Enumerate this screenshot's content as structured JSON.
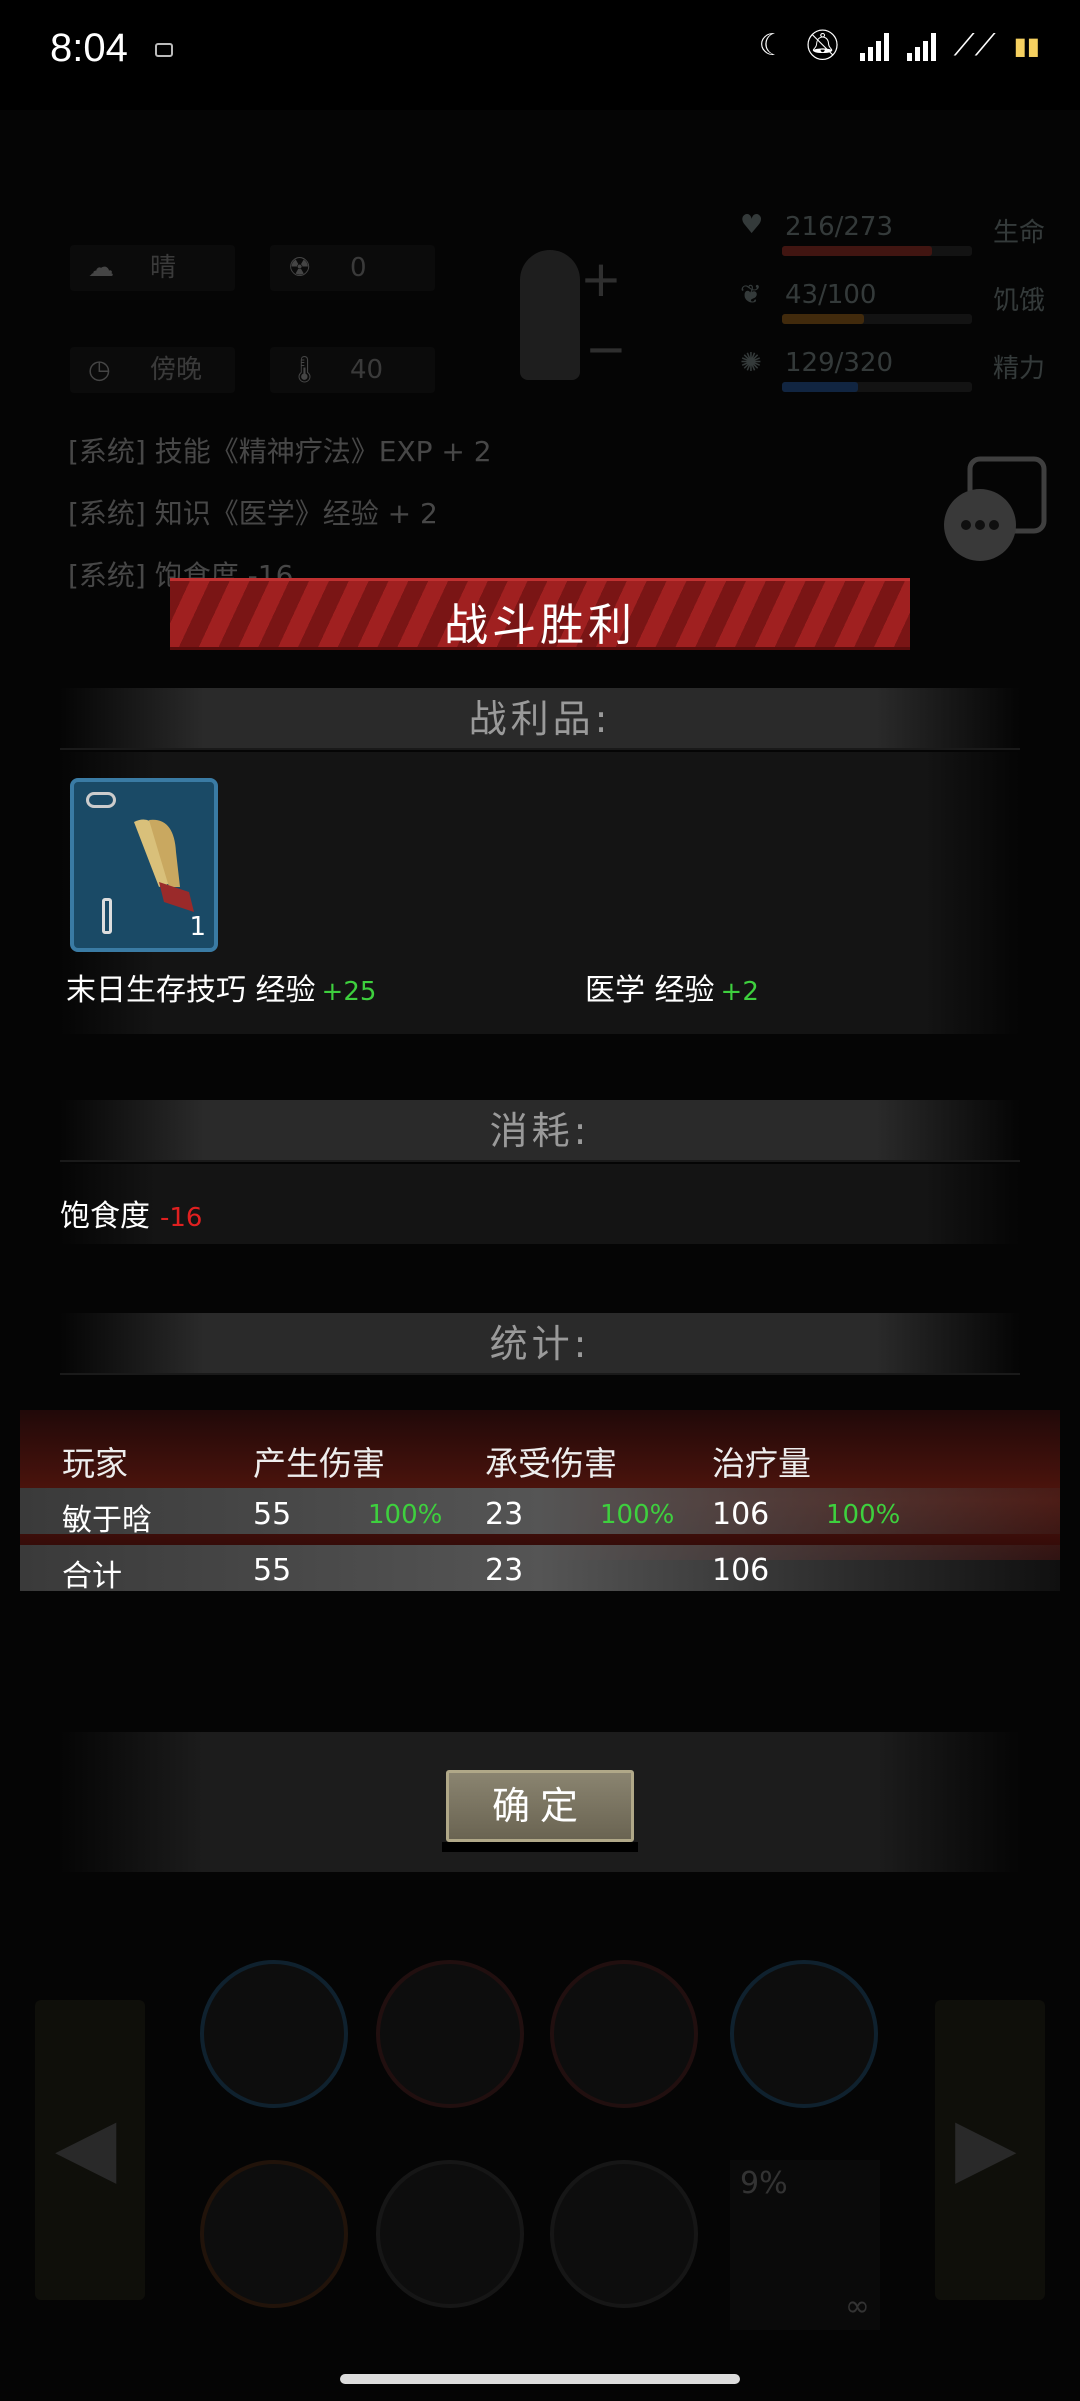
{
  "status_bar": {
    "time": "8:04",
    "icons": [
      "moon-icon",
      "mute-icon",
      "signal-hd-icon",
      "signal-hd-icon",
      "wifi-icon",
      "battery-icon"
    ]
  },
  "hud": {
    "weather": "晴",
    "radiation": "0",
    "time_of_day": "傍晚",
    "temperature": "40",
    "health": {
      "value": "216/273",
      "label": "生命",
      "fraction": 0.79,
      "color": "#c0392b"
    },
    "hunger": {
      "value": "43/100",
      "label": "饥饿",
      "fraction": 0.43,
      "color": "#c07a1b"
    },
    "energy": {
      "value": "129/320",
      "label": "精力",
      "fraction": 0.4,
      "color": "#2b6ac0"
    }
  },
  "log": {
    "line1": "[系统] 技能《精神疗法》EXP + 2",
    "line2": "[系统] 知识《医学》经验 + 2",
    "line3": "[系统] 饱食度 -16"
  },
  "dialog": {
    "title": "战斗胜利",
    "loot_header": "战利品:",
    "loot_item": {
      "name": "claw-item",
      "count": "1"
    },
    "exp1_label": "末日生存技巧 经验",
    "exp1_value": "+25",
    "exp2_label": "医学 经验",
    "exp2_value": "+2",
    "consume_header": "消耗:",
    "consume_label": "饱食度",
    "consume_value": "-16",
    "stats_header": "统计:",
    "columns": [
      "玩家",
      "产生伤害",
      "承受伤害",
      "治疗量"
    ],
    "rows": [
      {
        "player": "敏于晗",
        "damage": "55",
        "damage_pct": "100%",
        "taken": "23",
        "taken_pct": "100%",
        "heal": "106",
        "heal_pct": "100%"
      },
      {
        "player": "合计",
        "damage": "55",
        "taken": "23",
        "heal": "106"
      }
    ],
    "confirm": "确定"
  },
  "skills": {
    "percent": "9%",
    "infinity": "∞"
  },
  "colors": {
    "accent_green": "#3ed03e",
    "accent_red": "#e02020",
    "banner_red": "#a02020"
  }
}
